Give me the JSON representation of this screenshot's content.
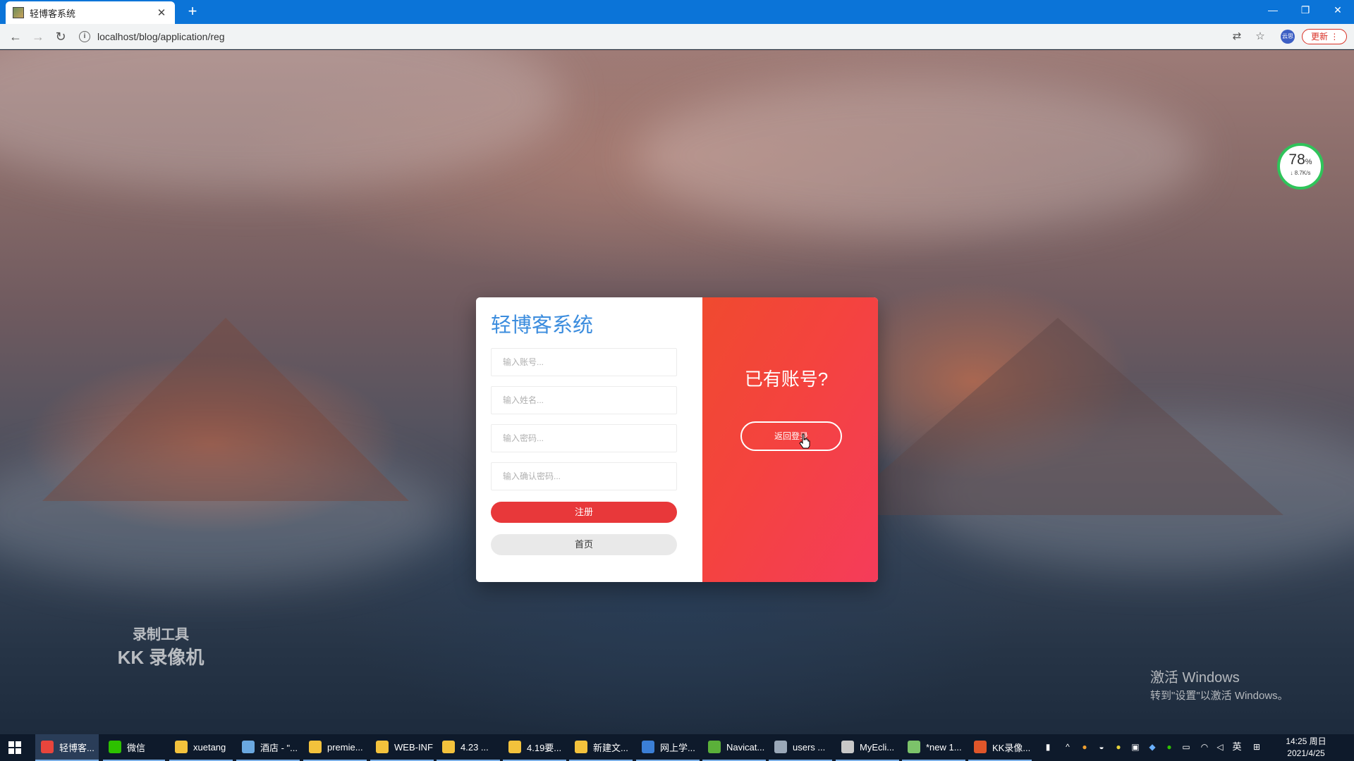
{
  "browser": {
    "tab_title": "轻博客系统",
    "url": "localhost/blog/application/reg",
    "update_label": "更新",
    "profile_label": "云思"
  },
  "register": {
    "title": "轻博客系统",
    "account_placeholder": "输入账号...",
    "name_placeholder": "输入姓名...",
    "password_placeholder": "输入密码...",
    "confirm_placeholder": "输入确认密码...",
    "register_label": "注册",
    "home_label": "首页"
  },
  "login_panel": {
    "question": "已有账号?",
    "back_label": "返回登录"
  },
  "speed_widget": {
    "percent": "78",
    "percent_unit": "%",
    "rate": "↓ 8.7K/s"
  },
  "overlays": {
    "recorder_line1": "录制工具",
    "recorder_line2": "KK 录像机",
    "activate_line1": "激活 Windows",
    "activate_line2": "转到\"设置\"以激活 Windows。"
  },
  "taskbar": {
    "items": [
      {
        "label": "轻博客...",
        "color": "#e8453c"
      },
      {
        "label": "微信",
        "color": "#2dc100"
      },
      {
        "label": "xuetang",
        "color": "#f3c23c"
      },
      {
        "label": "酒店 - \"...",
        "color": "#6aa8e0"
      },
      {
        "label": "premie...",
        "color": "#f3c23c"
      },
      {
        "label": "WEB-INF",
        "color": "#f3c23c"
      },
      {
        "label": "4.23 ...",
        "color": "#f3c23c"
      },
      {
        "label": "4.19要...",
        "color": "#f3c23c"
      },
      {
        "label": "新建文...",
        "color": "#f3c23c"
      },
      {
        "label": "网上学...",
        "color": "#3b7fd6"
      },
      {
        "label": "Navicat...",
        "color": "#5bb03a"
      },
      {
        "label": "users ...",
        "color": "#9aa8b8"
      },
      {
        "label": "MyEcli...",
        "color": "#c8c8c8"
      },
      {
        "label": "*new 1...",
        "color": "#7cc36a"
      },
      {
        "label": "KK录像...",
        "color": "#e0562a"
      }
    ],
    "ime": "英",
    "time": "14:25 周日",
    "date": "2021/4/25"
  }
}
